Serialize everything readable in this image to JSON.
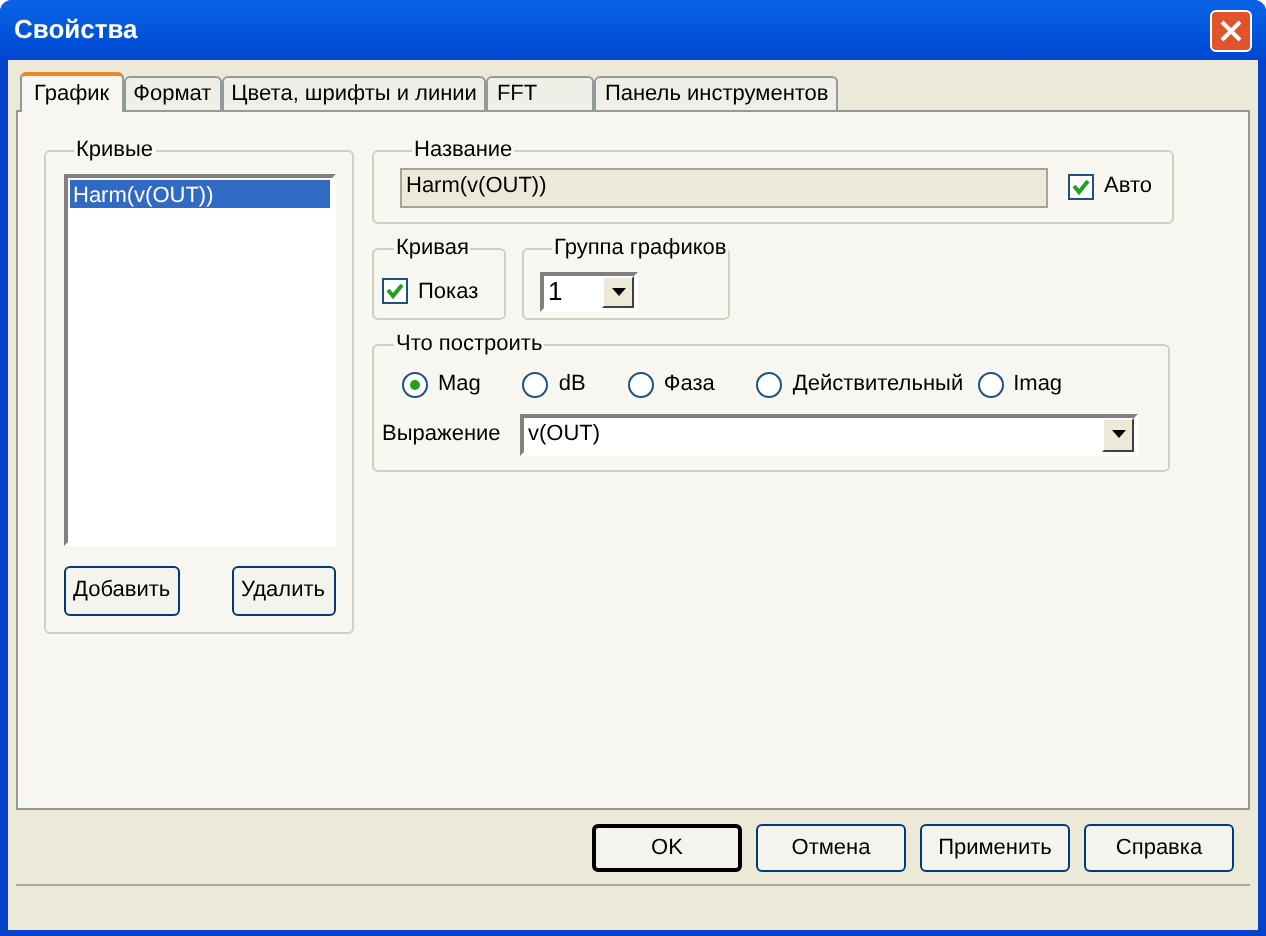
{
  "window": {
    "title": "Свойства"
  },
  "tabs": [
    {
      "label": "График",
      "selected": true
    },
    {
      "label": "Формат",
      "selected": false
    },
    {
      "label": "Цвета, шрифты и линии",
      "selected": false
    },
    {
      "label": "FFT",
      "selected": false
    },
    {
      "label": "Панель инструментов",
      "selected": false
    }
  ],
  "curves_group": {
    "title": "Кривые",
    "items": [
      {
        "label": "Harm(v(OUT))",
        "selected": true
      }
    ],
    "buttons": [
      "Добавить",
      "Удалить"
    ]
  },
  "name_group": {
    "title": "Название",
    "value": "Harm(v(OUT))",
    "auto": {
      "label": "Авто",
      "checked": true
    }
  },
  "curve_group": {
    "title": "Кривая",
    "show": {
      "label": "Показ",
      "checked": true
    }
  },
  "plot_group": {
    "title": "Группа графиков",
    "value": "1"
  },
  "plot_what": {
    "title": "Что построить",
    "options": [
      {
        "label": "Mag",
        "selected": true
      },
      {
        "label": "dB",
        "selected": false
      },
      {
        "label": "Фаза",
        "selected": false
      },
      {
        "label": "Действительный",
        "selected": false
      },
      {
        "label": "Imag",
        "selected": false
      }
    ],
    "expression": {
      "label": "Выражение",
      "value": "v(OUT)"
    }
  },
  "buttons": [
    {
      "label": "OK",
      "default": true
    },
    {
      "label": "Отмена",
      "default": false
    },
    {
      "label": "Применить",
      "default": false
    },
    {
      "label": "Справка",
      "default": false
    }
  ]
}
